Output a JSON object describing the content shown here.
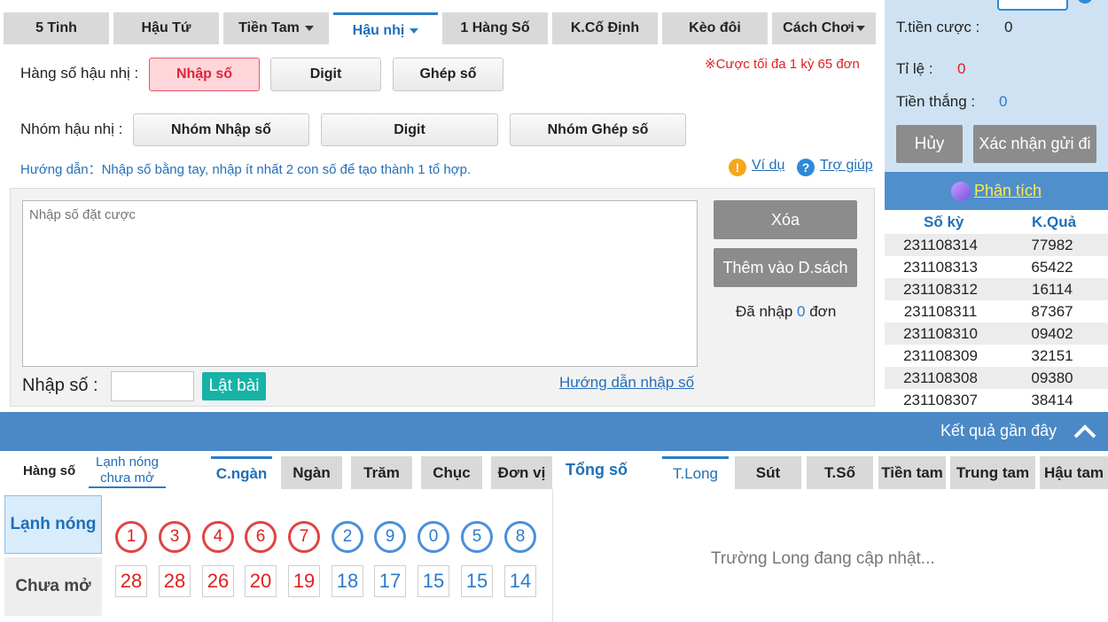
{
  "top_tabs": [
    {
      "label": "5 Tinh"
    },
    {
      "label": "Hậu Tứ"
    },
    {
      "label": "Tiền Tam"
    },
    {
      "label": "Hậu nhị"
    },
    {
      "label": "1 Hàng Số"
    },
    {
      "label": "K.Cố Định"
    },
    {
      "label": "Kèo đôi"
    },
    {
      "label": "Cách Chơi"
    }
  ],
  "row1": {
    "label": "Hàng số hậu nhị :",
    "buttons": [
      "Nhập số",
      "Digit",
      "Ghép số"
    ],
    "note": "※Cược tối đa 1 kỳ 65 đơn"
  },
  "row2": {
    "label": "Nhóm hậu nhị :",
    "buttons": [
      "Nhóm Nhập số",
      "Digit",
      "Nhóm Ghép số"
    ]
  },
  "guide": {
    "text": "Hướng dẫn：Nhập số bằng tay, nhập ít nhất 2 con số để tạo thành 1 tổ hợp.",
    "example": "Ví dụ",
    "help": "Trợ giúp"
  },
  "entry": {
    "placeholder": "Nhập số đặt cược",
    "delete": "Xóa",
    "add": "Thêm vào D.sách",
    "entered_prefix": "Đã nhập",
    "entered_count": "0",
    "entered_suffix": "đơn",
    "input_label": "Nhập số :",
    "flip": "Lật bài",
    "guide_link": "Hướng dẫn nhập số"
  },
  "right": {
    "bet_label": "T.tiền cược :",
    "bet_value": "0",
    "ratio_label": "Tỉ lệ :",
    "ratio_value": "0",
    "win_label": "Tiền thắng :",
    "win_value": "0",
    "cancel": "Hủy",
    "confirm": "Xác nhận gửi đi",
    "analysis": "Phân tích",
    "col1": "Số kỳ",
    "col2": "K.Quả",
    "results": [
      {
        "period": "231108314",
        "result": "77982"
      },
      {
        "period": "231108313",
        "result": "65422"
      },
      {
        "period": "231108312",
        "result": "16114"
      },
      {
        "period": "231108311",
        "result": "87367"
      },
      {
        "period": "231108310",
        "result": "09402"
      },
      {
        "period": "231108309",
        "result": "32151"
      },
      {
        "period": "231108308",
        "result": "09380"
      },
      {
        "period": "231108307",
        "result": "38414"
      }
    ]
  },
  "recent": {
    "title": "Kết quả gần đây"
  },
  "bottom": {
    "hang_so": "Hàng số",
    "lanh_nong_tab": "Lạnh nóng chưa mở",
    "tabs": [
      "C.ngàn",
      "Ngàn",
      "Trăm",
      "Chục",
      "Đơn vị"
    ],
    "tong_so": "Tổng số",
    "long_tabs": [
      "T.Long",
      "Sút",
      "T.Số",
      "Tiền tam",
      "Trung tam",
      "Hậu tam"
    ],
    "side_hot": "Lạnh nóng",
    "side_cold": "Chưa mở",
    "digits": [
      "1",
      "3",
      "4",
      "6",
      "7",
      "2",
      "9",
      "0",
      "5",
      "8"
    ],
    "counts": [
      "28",
      "28",
      "26",
      "20",
      "19",
      "18",
      "17",
      "15",
      "15",
      "14"
    ],
    "long_status": "Trường Long đang cập nhật..."
  },
  "colors": {
    "accent": "#2b7fc4",
    "red": "#e02020",
    "blue_bar": "#4a89c6",
    "teal": "#17b3a8"
  }
}
